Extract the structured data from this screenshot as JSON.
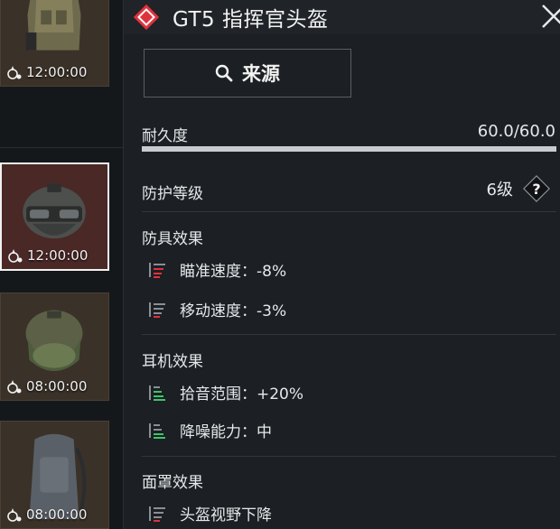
{
  "colors": {
    "negative": "#e0323c",
    "positive": "#3ec46a",
    "neutral": "#8a8f96",
    "brand": "#e0323c"
  },
  "left_column": {
    "slots": [
      {
        "timer": "12:00:00",
        "icon": "tactical-vest-item",
        "selected": false
      },
      {
        "timer": "12:00:00",
        "icon": "commander-helmet-item",
        "selected": true
      },
      {
        "timer": "08:00:00",
        "icon": "ballistic-helmet-item",
        "selected": false
      },
      {
        "timer": "08:00:00",
        "icon": "backpack-item",
        "selected": false
      }
    ]
  },
  "detail": {
    "title": "GT5 指挥官头盔",
    "source_button": "来源",
    "durability": {
      "label": "耐久度",
      "value": "60.0/60.0",
      "fraction": 1.0
    },
    "protection": {
      "label": "防护等级",
      "value": "6级",
      "help": "?"
    },
    "armor_effects": {
      "heading": "防具效果",
      "items": [
        {
          "text": "瞄准速度：-8%",
          "type": "negative"
        },
        {
          "text": "移动速度：-3%",
          "type": "negative"
        }
      ]
    },
    "headset_effects": {
      "heading": "耳机效果",
      "items": [
        {
          "text": "拾音范围：+20%",
          "type": "positive"
        },
        {
          "text": "降噪能力：中",
          "type": "positive"
        }
      ]
    },
    "visor_effects": {
      "heading": "面罩效果",
      "items": [
        {
          "text": "头盔视野下降",
          "type": "negative"
        }
      ]
    }
  }
}
